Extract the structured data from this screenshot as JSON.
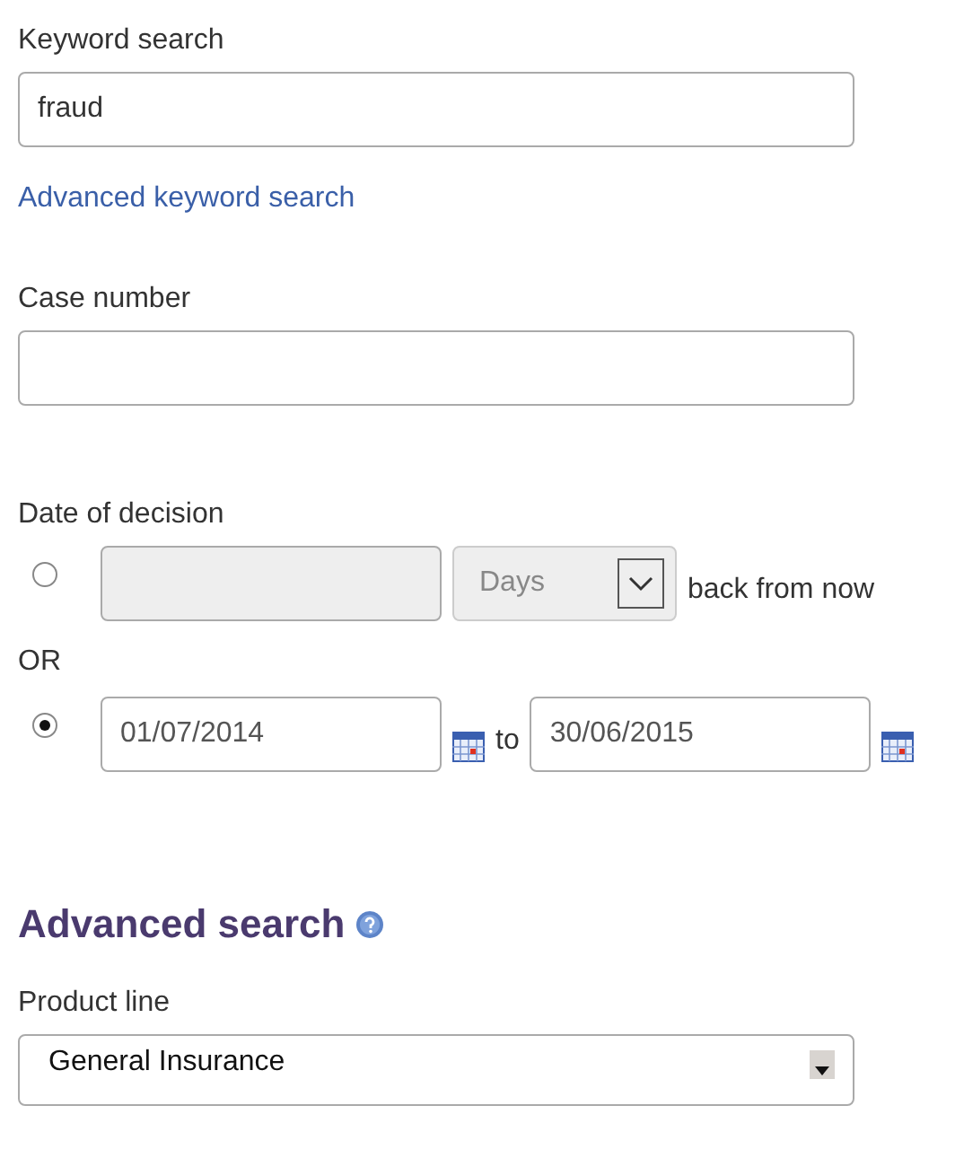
{
  "keyword_search": {
    "label": "Keyword search",
    "value": "fraud"
  },
  "advanced_link": "Advanced keyword search",
  "case_number": {
    "label": "Case number"
  },
  "date_of_decision": {
    "label": "Date of decision",
    "or_label": "OR",
    "options": [
      {
        "kind": "relative",
        "selected": false,
        "unit": "Days",
        "suffix": "back from now"
      },
      {
        "kind": "range",
        "selected": true,
        "from": "01/07/2014",
        "joiner": "to",
        "to": "30/06/2015"
      }
    ]
  },
  "advanced_search": {
    "title": "Advanced search"
  },
  "product_line": {
    "label": "Product line",
    "value": "General Insurance"
  }
}
